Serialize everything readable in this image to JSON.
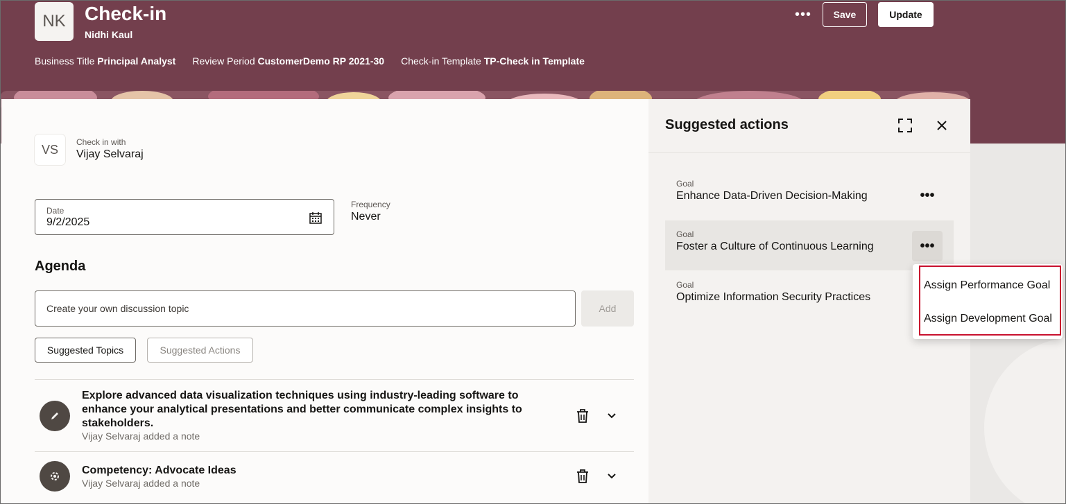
{
  "header": {
    "avatar_initials": "NK",
    "title": "Check-in",
    "person": "Nidhi Kaul",
    "meta": [
      {
        "label": "Business Title",
        "value": "Principal Analyst"
      },
      {
        "label": "Review Period",
        "value": "CustomerDemo RP 2021-30"
      },
      {
        "label": "Check-in Template",
        "value": "TP-Check in Template"
      }
    ],
    "more_label": "•••",
    "save_label": "Save",
    "update_label": "Update"
  },
  "checkin_with": {
    "avatar_initials": "VS",
    "label": "Check in with",
    "name": "Vijay Selvaraj"
  },
  "date_field": {
    "label": "Date",
    "value": "9/2/2025",
    "icon": "calendar-icon"
  },
  "frequency": {
    "label": "Frequency",
    "value": "Never"
  },
  "agenda": {
    "title": "Agenda",
    "input_placeholder": "Create your own discussion topic",
    "add_label": "Add",
    "suggested_topics_label": "Suggested Topics",
    "suggested_actions_label": "Suggested Actions",
    "items": [
      {
        "icon": "pencil-icon",
        "title": "Explore advanced data visualization techniques using industry-leading software to enhance your analytical presentations and better communicate complex insights to stakeholders.",
        "subtitle": "Vijay Selvaraj added a note"
      },
      {
        "icon": "competency-icon",
        "title": "Competency: Advocate Ideas",
        "subtitle": "Vijay Selvaraj added a note"
      }
    ]
  },
  "side_panel": {
    "title": "Suggested actions",
    "goals": [
      {
        "kind": "Goal",
        "name": "Enhance Data-Driven Decision-Making"
      },
      {
        "kind": "Goal",
        "name": "Foster a Culture of Continuous Learning"
      },
      {
        "kind": "Goal",
        "name": "Optimize Information Security Practices"
      }
    ],
    "more_label": "•••"
  },
  "menu": {
    "items": [
      "Assign Performance Goal",
      "Assign Development Goal"
    ],
    "highlight_color": "#c8102e"
  },
  "colors": {
    "brand": "#733f4d"
  }
}
